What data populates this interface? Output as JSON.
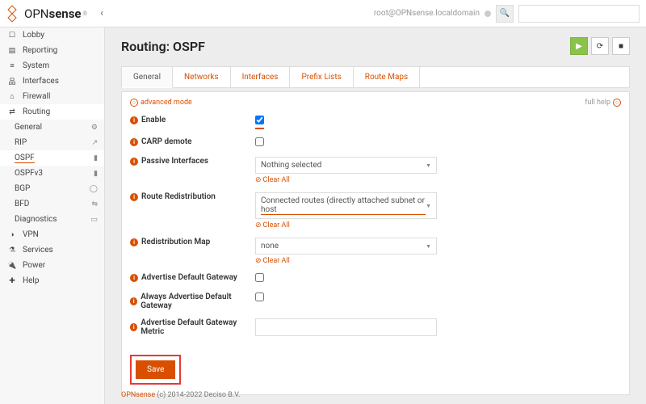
{
  "header": {
    "logo_main": "OPN",
    "logo_sub": "sense",
    "user": "root@OPNsense.localdomain"
  },
  "sidebar": {
    "items": [
      {
        "label": "Lobby",
        "icon": "🏠"
      },
      {
        "label": "Reporting",
        "icon": "📊"
      },
      {
        "label": "System",
        "icon": "☰"
      },
      {
        "label": "Interfaces",
        "icon": "⚙"
      },
      {
        "label": "Firewall",
        "icon": "🛡"
      },
      {
        "label": "Routing",
        "icon": "⇄",
        "active": true
      },
      {
        "label": "VPN",
        "icon": "🔒"
      },
      {
        "label": "Services",
        "icon": "⚗"
      },
      {
        "label": "Power",
        "icon": "🔌"
      },
      {
        "label": "Help",
        "icon": "✚"
      }
    ],
    "routing_children": [
      {
        "label": "General",
        "icon": "⚙"
      },
      {
        "label": "RIP",
        "icon": "↗"
      },
      {
        "label": "OSPF",
        "icon": "🏴",
        "selected": true,
        "underline": true
      },
      {
        "label": "OSPFv3",
        "icon": "🏴"
      },
      {
        "label": "BGP",
        "icon": "🌐"
      },
      {
        "label": "BFD",
        "icon": "⇋"
      },
      {
        "label": "Diagnostics",
        "icon": "💼"
      }
    ]
  },
  "page": {
    "title": "Routing: OSPF",
    "tabs": [
      "General",
      "Networks",
      "Interfaces",
      "Prefix Lists",
      "Route Maps"
    ],
    "active_tab": "General",
    "advanced_mode": "advanced mode",
    "full_help": "full help",
    "clear_all": "Clear All",
    "save": "Save"
  },
  "form": {
    "enable": {
      "label": "Enable",
      "checked": true
    },
    "carp_demote": {
      "label": "CARP demote",
      "checked": false
    },
    "passive_interfaces": {
      "label": "Passive Interfaces",
      "value": "Nothing selected"
    },
    "route_redistribution": {
      "label": "Route Redistribution",
      "value": "Connected routes (directly attached subnet or host"
    },
    "redistribution_map": {
      "label": "Redistribution Map",
      "value": "none"
    },
    "adv_default_gw": {
      "label": "Advertise Default Gateway",
      "checked": false
    },
    "always_adv_default_gw": {
      "label": "Always Advertise Default Gateway",
      "checked": false
    },
    "adv_default_gw_metric": {
      "label": "Advertise Default Gateway Metric",
      "value": ""
    }
  },
  "footer": {
    "brand": "OPNsense",
    "text": " (c) 2014-2022 Deciso B.V."
  }
}
